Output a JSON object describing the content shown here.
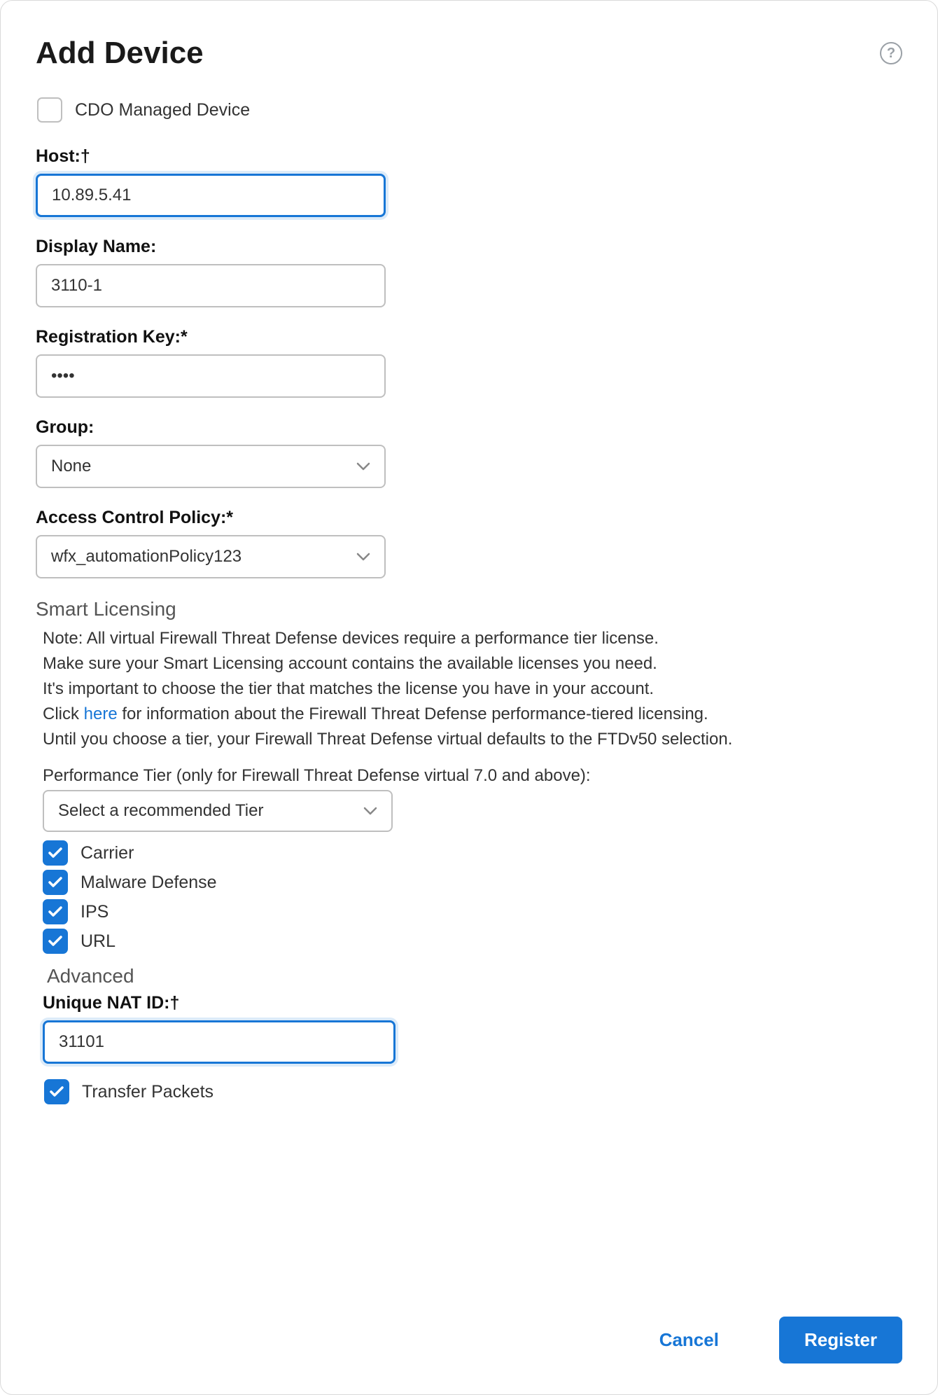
{
  "dialog": {
    "title": "Add Device",
    "cdo": {
      "label": "CDO Managed Device",
      "checked": false
    },
    "host": {
      "label": "Host:†",
      "value": "10.89.5.41"
    },
    "displayName": {
      "label": "Display Name:",
      "value": "3110-1"
    },
    "regKey": {
      "label": "Registration Key:*",
      "value": "••••"
    },
    "group": {
      "label": "Group:",
      "value": "None"
    },
    "acp": {
      "label": "Access Control Policy:*",
      "value": "wfx_automationPolicy123"
    },
    "smart": {
      "section": "Smart Licensing",
      "note1": "Note: All virtual Firewall Threat Defense devices require a performance tier license.",
      "note2": "Make sure your Smart Licensing account contains the available licenses you need.",
      "note3": "It's important to choose the tier that matches the license you have in your account.",
      "note4a": "Click ",
      "note4link": "here",
      "note4b": " for information about the Firewall Threat Defense performance-tiered licensing.",
      "note5": "Until you choose a tier, your Firewall Threat Defense virtual defaults to the FTDv50 selection.",
      "perfLabel": "Performance Tier (only for Firewall Threat Defense virtual 7.0 and above):",
      "perfValue": "Select a recommended Tier",
      "licenses": [
        {
          "label": "Carrier",
          "checked": true
        },
        {
          "label": "Malware Defense",
          "checked": true
        },
        {
          "label": "IPS",
          "checked": true
        },
        {
          "label": "URL",
          "checked": true
        }
      ]
    },
    "advanced": {
      "section": "Advanced",
      "natLabel": "Unique NAT ID:†",
      "natValue": "31101",
      "transfer": {
        "label": "Transfer Packets",
        "checked": true
      }
    },
    "footer": {
      "cancel": "Cancel",
      "register": "Register"
    }
  }
}
